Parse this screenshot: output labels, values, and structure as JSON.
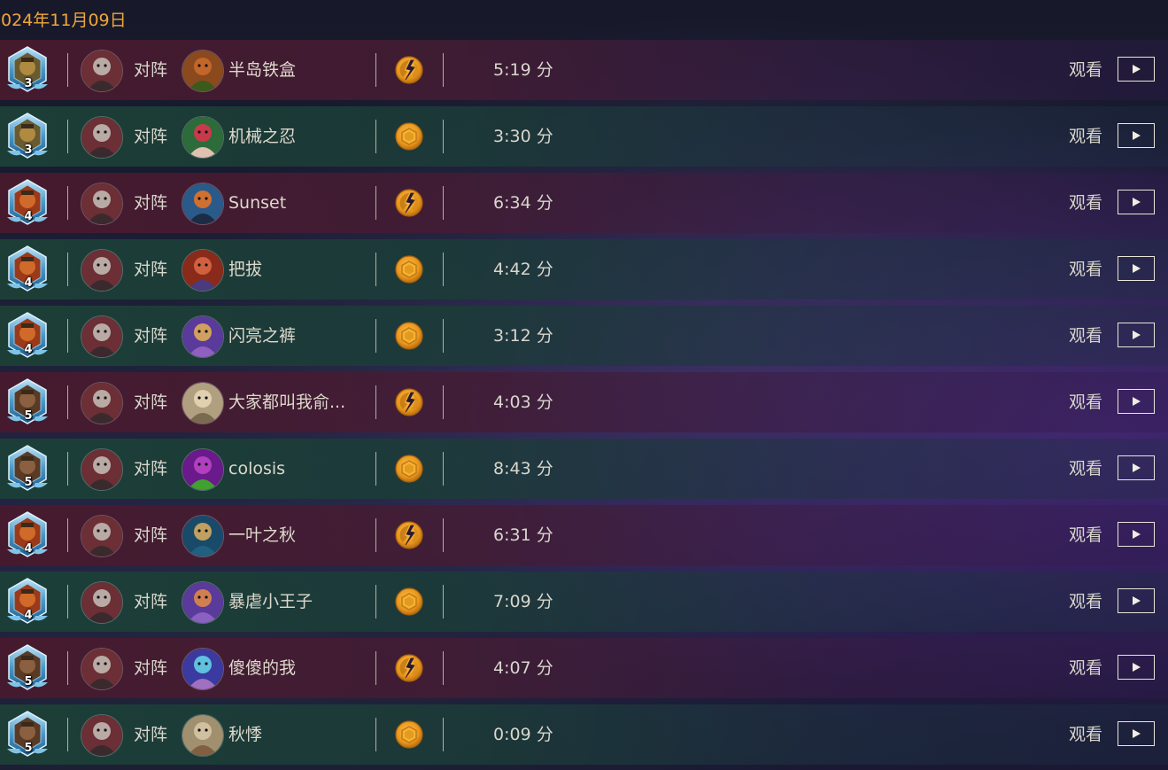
{
  "header": {
    "date": "024年11月09日"
  },
  "colors": {
    "accent": "#f0a63a",
    "win_row": "#1c4037",
    "lose_row": "#481a2d"
  },
  "matches": [
    {
      "rank": "3",
      "rank_icon": "bronze-hero-rank-icon",
      "player_icon": "hero-portrait-icon",
      "vs": "对阵",
      "opponent": "半岛铁盒",
      "opponent_icon": "opponent-portrait-icon",
      "result": "loss",
      "result_icon": "loss-broken-coin-icon",
      "duration": "5:19 分",
      "watch": "观看"
    },
    {
      "rank": "3",
      "rank_icon": "bronze-hero-rank-icon",
      "player_icon": "hero-portrait-icon",
      "vs": "对阵",
      "opponent": "机械之忍",
      "opponent_icon": "opponent-portrait-icon",
      "result": "win",
      "result_icon": "win-coin-icon",
      "duration": "3:30 分",
      "watch": "观看"
    },
    {
      "rank": "4",
      "rank_icon": "hero-rank-icon",
      "player_icon": "hero-portrait-icon",
      "vs": "对阵",
      "opponent": "Sunset",
      "opponent_icon": "opponent-portrait-icon",
      "result": "loss",
      "result_icon": "loss-broken-coin-icon",
      "duration": "6:34 分",
      "watch": "观看"
    },
    {
      "rank": "4",
      "rank_icon": "hero-rank-icon",
      "player_icon": "hero-portrait-icon",
      "vs": "对阵",
      "opponent": "把拔",
      "opponent_icon": "opponent-portrait-icon",
      "result": "win",
      "result_icon": "win-coin-icon",
      "duration": "4:42 分",
      "watch": "观看"
    },
    {
      "rank": "4",
      "rank_icon": "hero-rank-icon",
      "player_icon": "hero-portrait-icon",
      "vs": "对阵",
      "opponent": "闪亮之裤",
      "opponent_icon": "opponent-portrait-icon",
      "result": "win",
      "result_icon": "win-coin-icon",
      "duration": "3:12 分",
      "watch": "观看"
    },
    {
      "rank": "5",
      "rank_icon": "hero-rank-icon",
      "player_icon": "hero-portrait-icon",
      "vs": "对阵",
      "opponent": "大家都叫我俞...",
      "opponent_icon": "opponent-portrait-icon",
      "result": "loss",
      "result_icon": "loss-broken-coin-icon",
      "duration": "4:03 分",
      "watch": "观看"
    },
    {
      "rank": "5",
      "rank_icon": "hero-rank-icon",
      "player_icon": "hero-portrait-icon",
      "vs": "对阵",
      "opponent": "colosis",
      "opponent_icon": "opponent-portrait-icon",
      "result": "win",
      "result_icon": "win-coin-icon",
      "duration": "8:43 分",
      "watch": "观看"
    },
    {
      "rank": "4",
      "rank_icon": "hero-rank-icon",
      "player_icon": "hero-portrait-icon",
      "vs": "对阵",
      "opponent": "一叶之秋",
      "opponent_icon": "opponent-portrait-icon",
      "result": "loss",
      "result_icon": "loss-broken-coin-icon",
      "duration": "6:31 分",
      "watch": "观看"
    },
    {
      "rank": "4",
      "rank_icon": "hero-rank-icon",
      "player_icon": "hero-portrait-icon",
      "vs": "对阵",
      "opponent": "暴虐小王子",
      "opponent_icon": "opponent-portrait-icon",
      "result": "win",
      "result_icon": "win-coin-icon",
      "duration": "7:09 分",
      "watch": "观看"
    },
    {
      "rank": "5",
      "rank_icon": "hero-rank-icon",
      "player_icon": "hero-portrait-icon",
      "vs": "对阵",
      "opponent": "傻傻的我",
      "opponent_icon": "opponent-portrait-icon",
      "result": "loss",
      "result_icon": "loss-broken-coin-icon",
      "duration": "4:07 分",
      "watch": "观看"
    },
    {
      "rank": "5",
      "rank_icon": "hero-rank-icon",
      "player_icon": "hero-portrait-icon",
      "vs": "对阵",
      "opponent": "秋悸",
      "opponent_icon": "opponent-portrait-icon",
      "result": "win",
      "result_icon": "win-coin-icon",
      "duration": "0:09 分",
      "watch": "观看"
    }
  ]
}
